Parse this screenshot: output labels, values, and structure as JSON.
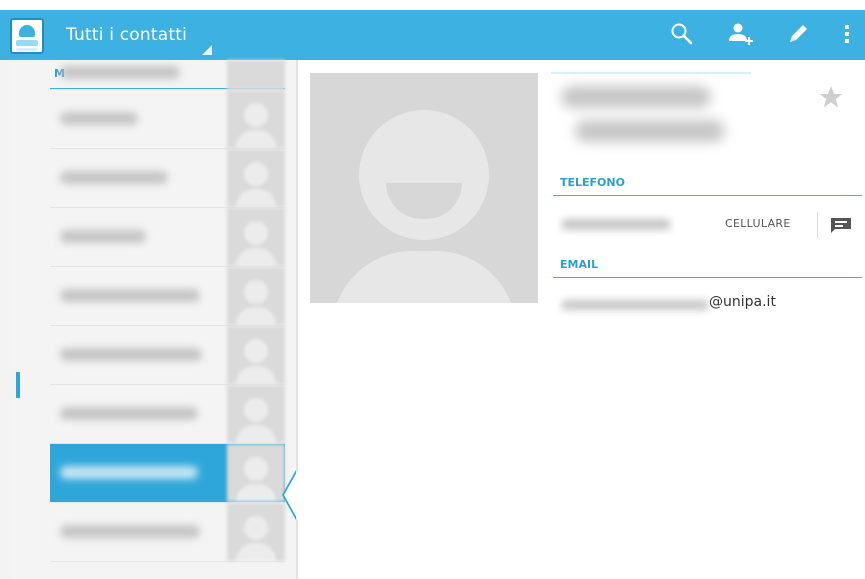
{
  "colors": {
    "accent": "#3db1e1",
    "accent_dark": "#2a9fd0",
    "selected": "#2fa6d9",
    "panel_bg": "#f4f4f4"
  },
  "actionbar": {
    "title": "Tutti i contatti",
    "icons": [
      "contacts-app-icon",
      "search-icon",
      "add-contact-icon",
      "edit-icon",
      "overflow-menu-icon"
    ]
  },
  "list": {
    "section_letter": "M",
    "selected_index": 7
  },
  "detail": {
    "telefono_label": "TELEFONO",
    "phone_type": "CELLULARE",
    "email_label": "EMAIL",
    "email_domain": "@unipa.it"
  }
}
